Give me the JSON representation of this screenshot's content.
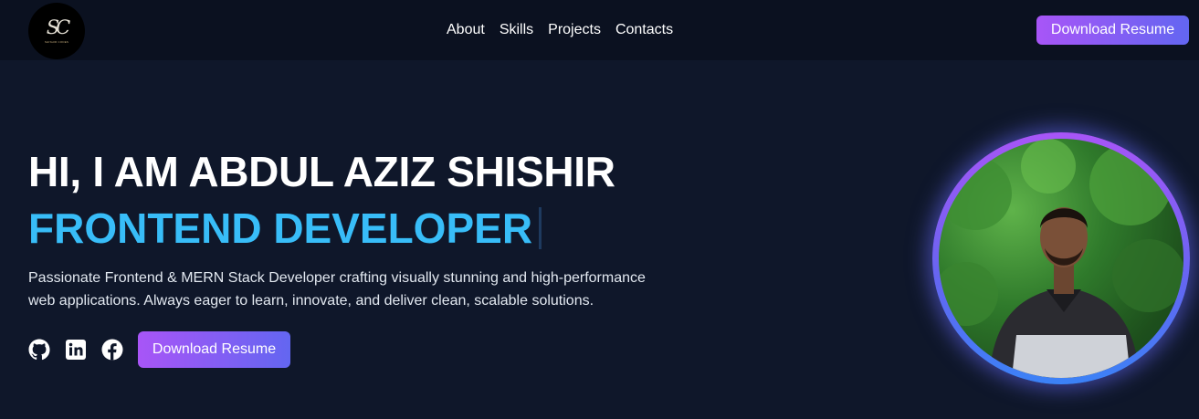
{
  "navbar": {
    "logo": {
      "mark": "SC",
      "subtitle": "SHISHIR CODES"
    },
    "links": [
      "About",
      "Skills",
      "Projects",
      "Contacts"
    ],
    "cta_label": "Download Resume"
  },
  "hero": {
    "title": "HI, I AM ABDUL AZIZ SHISHIR",
    "role": "FRONTEND DEVELOPER",
    "description": "Passionate Frontend & MERN Stack Developer crafting visually stunning and high-performance web applications. Always eager to learn, innovate, and deliver clean, scalable solutions.",
    "socials": [
      "github-icon",
      "linkedin-icon",
      "facebook-icon"
    ],
    "cta_label": "Download Resume"
  },
  "colors": {
    "background": "#0f172a",
    "navbar": "#0b1120",
    "accent_blue": "#38bdf8",
    "gradient_start": "#a855f7",
    "gradient_end": "#6366f1"
  }
}
